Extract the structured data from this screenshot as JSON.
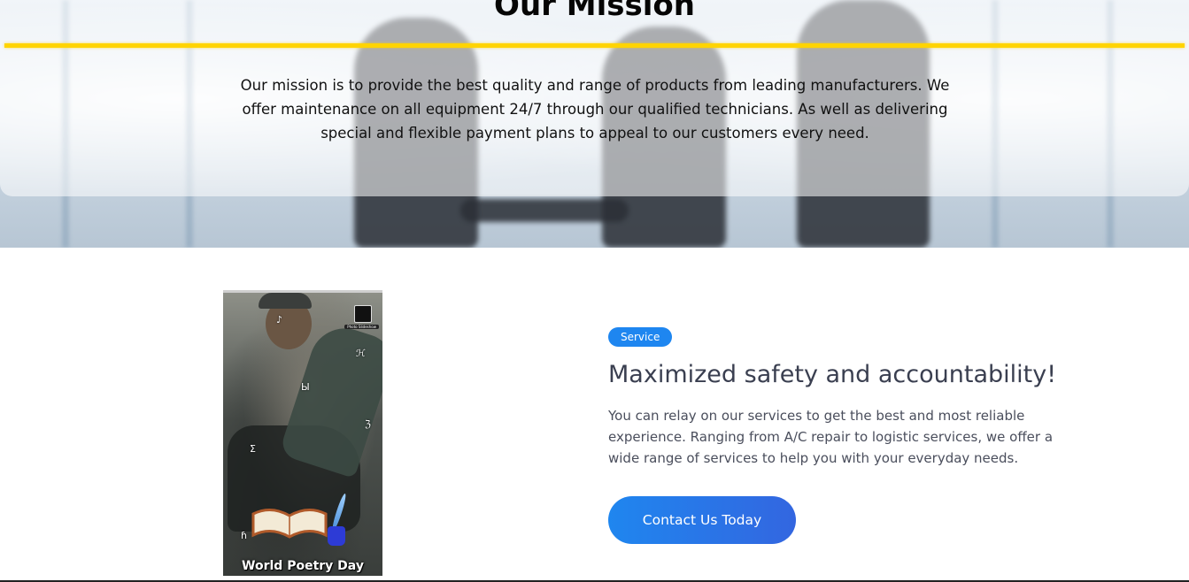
{
  "mission": {
    "title": "Our Mission",
    "text": "Our mission is to provide the best quality and range of products from leading manufacturers. We offer maintenance on all equipment 24/7 through our qualified technicians. As well as delivering special and flexible payment plans to appeal to our customers every need."
  },
  "video": {
    "caption": "World Poetry Day",
    "corner_label": "Photo Slideshow"
  },
  "service": {
    "badge": "Service",
    "title": "Maximized safety and accountability!",
    "text": "You can relay on our services to get the best and most reliable experience. Ranging from A/C repair to logistic services, we offer a wide range of services to help you with your everyday needs.",
    "button_label": "Contact Us Today"
  },
  "colors": {
    "accent_yellow": "#ffd400",
    "primary_blue": "#1e86f0",
    "heading": "#3a3f50"
  }
}
